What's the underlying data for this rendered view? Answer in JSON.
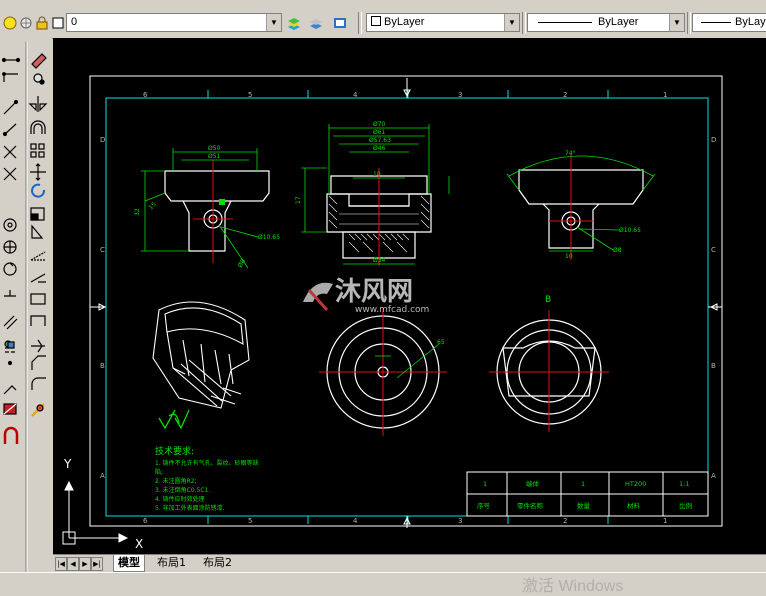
{
  "toolbar": {
    "layer_combo": "0",
    "color_combo": "ByLayer",
    "linetype_combo": "ByLayer",
    "lineweight_combo": "ByLay"
  },
  "tabs": [
    {
      "label": "模型"
    },
    {
      "label": "布局1"
    },
    {
      "label": "布局2"
    }
  ],
  "ucs": {
    "y_label": "Y",
    "x_label": "X"
  },
  "drawing": {
    "border_numbers_top": [
      "6",
      "5",
      "4",
      "3",
      "2",
      "1"
    ],
    "border_numbers_bottom": [
      "6",
      "5",
      "4",
      "3",
      "2",
      "1"
    ],
    "border_letters": [
      "D",
      "C",
      "B",
      "A"
    ],
    "section_label": "B",
    "dims": {
      "d50": "Ø50",
      "d51": "Ø51",
      "d32": "32",
      "d15": "15",
      "r10": "Ø10.65",
      "r8": "Ø8",
      "d70": "Ø70",
      "d61": "Ø61",
      "d57": "Ø57.63",
      "d46": "Ø46",
      "d10": "10",
      "d17": "17",
      "d34": "Ø34",
      "a74": "74°",
      "r10b": "Ø10.65",
      "r8b": "Ø8",
      "d10b": "10",
      "d65": "65"
    },
    "tech_title": "技术要求:",
    "tech_lines": [
      "1. 铸件不允许有气孔、裂纹、砂眼等缺",
      "陷;",
      "2. 未注圆角R2;",
      "3. 未注倒角C0.5C1.",
      "4. 铸件应时效处理",
      "5. 非加工外表面涂防锈漆."
    ],
    "title_block": {
      "row1": [
        "1",
        "端体",
        "1",
        "HT200",
        "1:1"
      ],
      "row2": [
        "序号",
        "零件名称",
        "数量",
        "材料",
        "比例"
      ]
    },
    "watermark_cn": "沐风网",
    "watermark_url": "www.mfcad.com"
  },
  "status": {
    "activate_text": "激活 Windows"
  }
}
